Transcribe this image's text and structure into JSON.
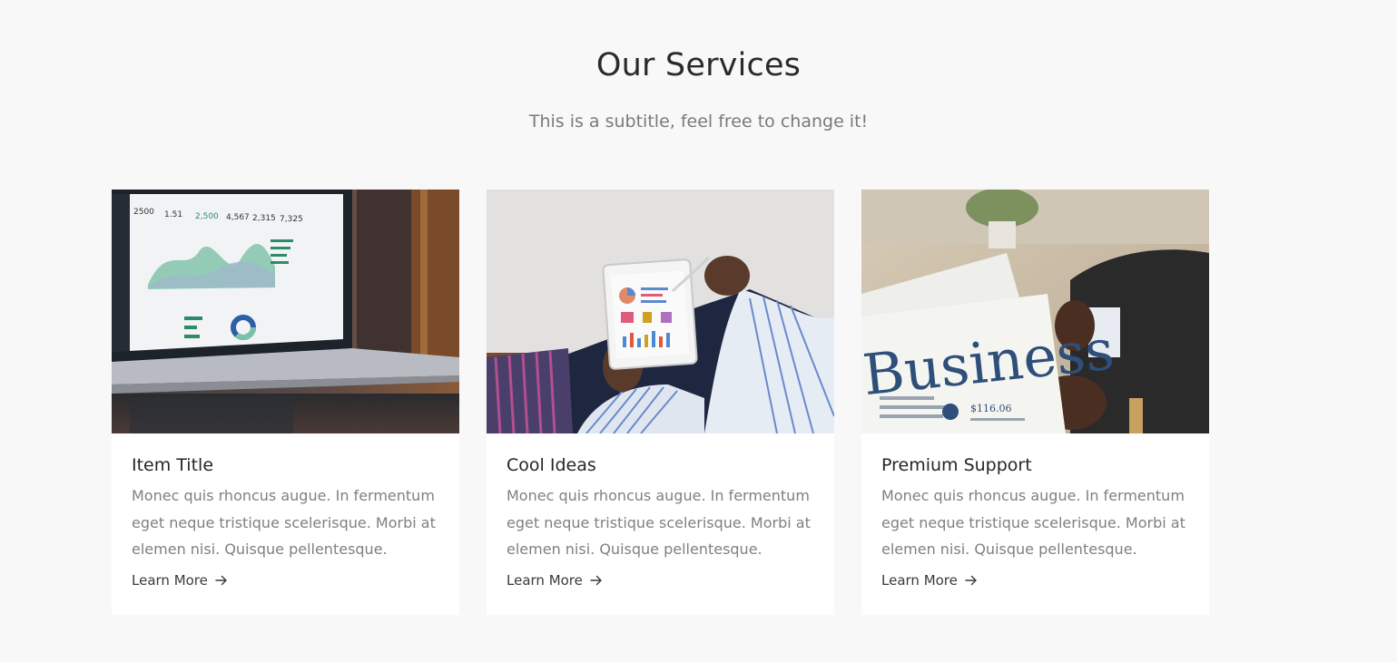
{
  "section": {
    "title": "Our Services",
    "subtitle": "This is a subtitle, feel free to change it!"
  },
  "cards": [
    {
      "image_icon": "laptop-dashboard-image",
      "title": "Item Title",
      "text": "Monec quis rhoncus augue. In fermentum eget neque tristique scelerisque. Morbi at elemen nisi. Quisque pellentesque.",
      "link_label": "Learn More"
    },
    {
      "image_icon": "tablet-charts-image",
      "title": "Cool Ideas",
      "text": "Monec quis rhoncus augue. In fermentum eget neque tristique scelerisque. Morbi at elemen nisi. Quisque pellentesque.",
      "link_label": "Learn More"
    },
    {
      "image_icon": "business-newspaper-image",
      "title": "Premium Support",
      "text": "Monec quis rhoncus augue. In fermentum eget neque tristique scelerisque. Morbi at elemen nisi. Quisque pellentesque.",
      "link_label": "Learn More"
    }
  ],
  "images": {
    "laptop_numbers": [
      "2500",
      "1.51",
      "2,500",
      "4,567",
      "2,315",
      "7,325"
    ],
    "newspaper_word": "Business",
    "newspaper_price": "$116.06"
  },
  "colors": {
    "background": "#f8f8f8",
    "card": "#ffffff",
    "title": "#2a2a2a",
    "subtitle": "#7a7a7a",
    "body_text": "#808080"
  }
}
